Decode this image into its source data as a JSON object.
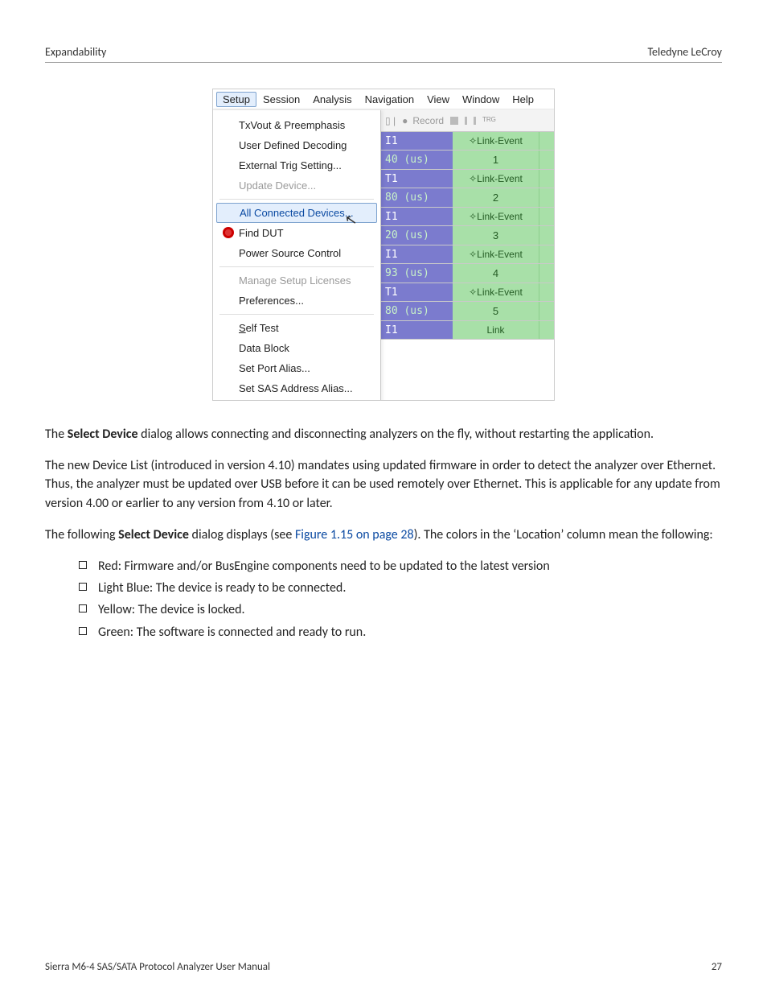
{
  "header": {
    "left": "Expandability",
    "right": "Teledyne LeCroy"
  },
  "footer": {
    "left": "Sierra M6-4 SAS/SATA Protocol Analyzer User Manual",
    "right": "27"
  },
  "menubar": [
    "Setup",
    "Session",
    "Analysis",
    "Navigation",
    "View",
    "Window",
    "Help"
  ],
  "toolbar": {
    "record": "Record"
  },
  "dropdown": {
    "items": [
      {
        "t": "TxVout & Preemphasis",
        "cls": ""
      },
      {
        "t": "User Defined Decoding",
        "cls": ""
      },
      {
        "t": "External Trig Setting...",
        "cls": ""
      },
      {
        "t": "Update Device...",
        "cls": "muted"
      },
      {
        "sep": true
      },
      {
        "t": "All Connected Devices...",
        "cls": "sel"
      },
      {
        "t": "Find DUT",
        "cls": "icon"
      },
      {
        "t": "Power Source Control",
        "cls": ""
      },
      {
        "sep": true
      },
      {
        "t": "Manage Setup Licenses",
        "cls": "muted"
      },
      {
        "t": "Preferences...",
        "cls": ""
      },
      {
        "sep": true
      },
      {
        "t": "Self Test",
        "cls": "",
        "u": "S"
      },
      {
        "t": "Data Block",
        "cls": ""
      },
      {
        "t": "Set Port Alias...",
        "cls": ""
      },
      {
        "t": "Set SAS Address Alias...",
        "cls": ""
      }
    ]
  },
  "datarows": [
    {
      "a": "I1",
      "ev": "Link-Event",
      "hdr": true
    },
    {
      "a": "40 (us)",
      "ev": "1"
    },
    {
      "a": "T1",
      "ev": "Link-Event",
      "hdr": true
    },
    {
      "a": "80 (us)",
      "ev": "2"
    },
    {
      "a": "I1",
      "ev": "Link-Event",
      "hdr": true
    },
    {
      "a": "20 (us)",
      "ev": "3"
    },
    {
      "a": "I1",
      "ev": "Link-Event",
      "hdr": true
    },
    {
      "a": "93 (us)",
      "ev": "4"
    },
    {
      "a": "T1",
      "ev": "Link-Event",
      "hdr": true
    },
    {
      "a": "80 (us)",
      "ev": "5"
    },
    {
      "a": "I1",
      "ev": "Link",
      "hdr": true
    }
  ],
  "para1_pre": "The ",
  "para1_b": "Select Device",
  "para1_post": " dialog allows connecting and disconnecting analyzers on the fly, without restarting the application.",
  "para2": "The new Device List (introduced in version 4.10) mandates using updated firmware in order to detect the analyzer over Ethernet. Thus, the analyzer must be updated over USB before it can be used remotely over Ethernet. This is applicable for any update from version 4.00 or earlier to any version from 4.10 or later.",
  "para3_pre": "The following ",
  "para3_b": "Select Device",
  "para3_mid": " dialog displays (see ",
  "para3_xref": "Figure 1.15 on page 28",
  "para3_post": "). The colors in the ‘Location’ column mean the following:",
  "bullets": [
    "Red: Firmware and/or BusEngine components need to be updated to the latest version",
    "Light Blue: The device is ready to be connected.",
    "Yellow: The device is locked.",
    "Green: The software is connected and ready to run."
  ]
}
